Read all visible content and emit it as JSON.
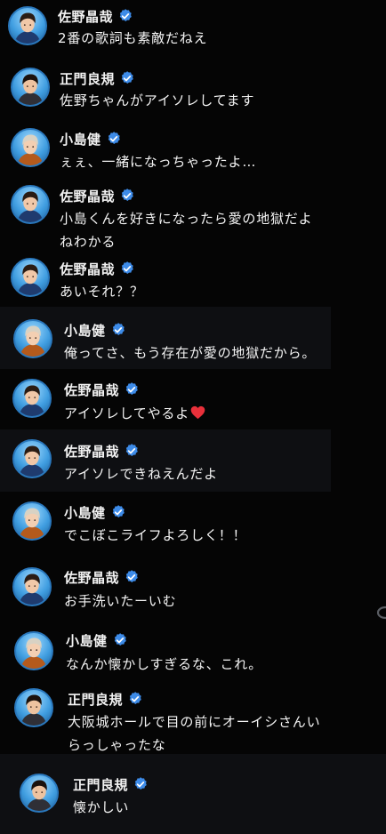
{
  "comments": [
    {
      "name": "佐野晶哉",
      "lines": [
        "2番の歌詞も素敵だねえ"
      ]
    },
    {
      "name": "正門良規",
      "lines": [
        "佐野ちゃんがアイソレしてます"
      ]
    },
    {
      "name": "小島健",
      "lines": [
        "ぇぇ、一緒になっちゃったよ…"
      ]
    },
    {
      "name": "佐野晶哉",
      "lines": [
        "小島くんを好きになったら愛の地獄だよ",
        "ねわかる"
      ]
    },
    {
      "name": "佐野晶哉",
      "lines": [
        "あいそれ？？"
      ]
    },
    {
      "name": "小島健",
      "lines": [
        "俺ってさ、もう存在が愛の地獄だから。"
      ]
    },
    {
      "name": "佐野晶哉",
      "lines": [
        "アイソレしてやるよ"
      ],
      "emoji": "red-heart"
    },
    {
      "name": "佐野晶哉",
      "lines": [
        "アイソレできねえんだよ"
      ]
    },
    {
      "name": "小島健",
      "lines": [
        "でこぼこライフよろしく！！"
      ]
    },
    {
      "name": "佐野晶哉",
      "lines": [
        "お手洗いたーいむ"
      ]
    },
    {
      "name": "小島健",
      "lines": [
        "なんか懐かしすぎるな、これ。"
      ]
    },
    {
      "name": "正門良規",
      "lines": [
        "大阪城ホールで目の前にオーイシさんい",
        "らっしゃったな"
      ]
    },
    {
      "name": "正門良規",
      "lines": [
        "懐かしい"
      ]
    }
  ],
  "icons": {
    "verified": "verified-badge-icon",
    "emoji": "red-heart-emoji-icon"
  },
  "colors": {
    "background": "#050505",
    "band": "#0e0f12",
    "text": "#f4f4f4",
    "badge": "#3d8be8",
    "heart": "#e8303a",
    "avatar": "#3f9de0"
  }
}
